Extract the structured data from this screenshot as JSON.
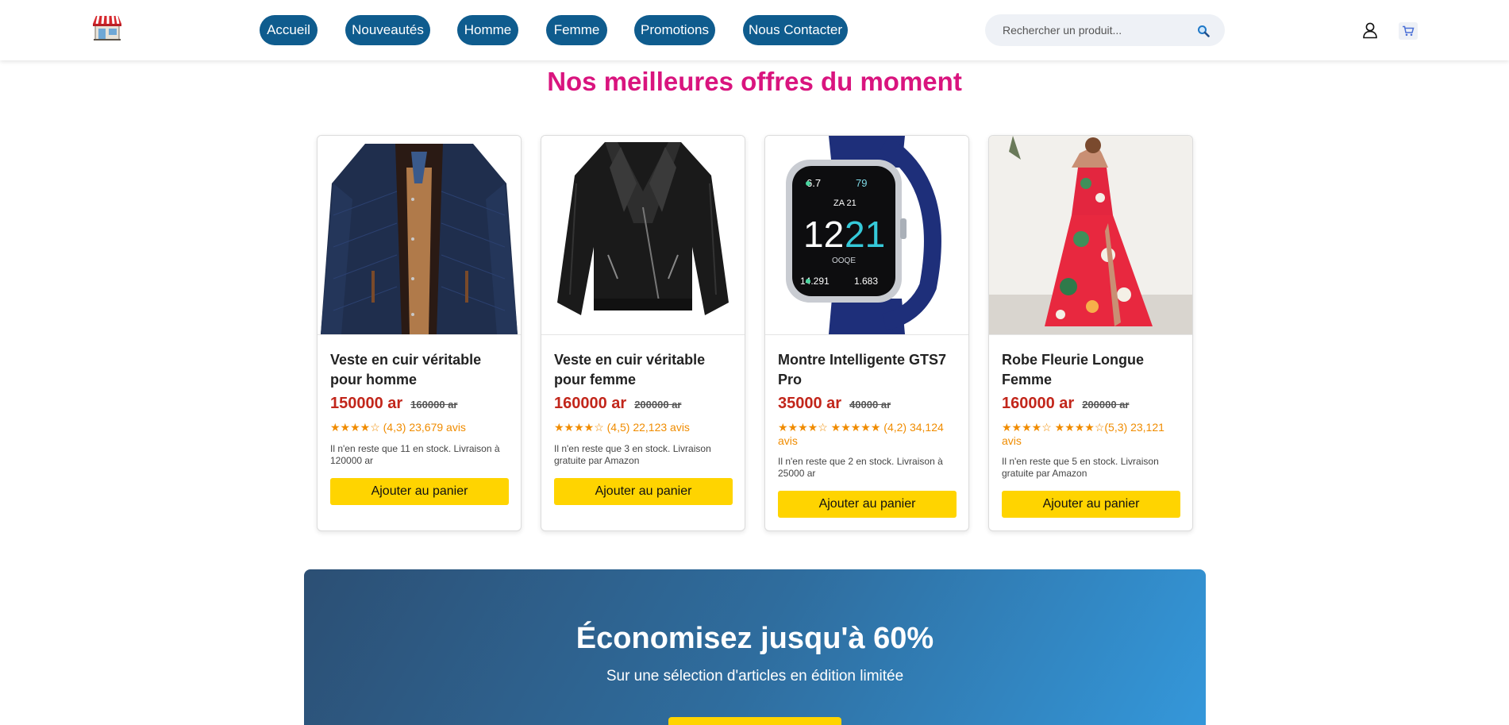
{
  "brand": {
    "logo_icon": "shop-storefront-icon"
  },
  "nav": {
    "items": [
      {
        "label": "Accueil"
      },
      {
        "label": "Nouveautés"
      },
      {
        "label": "Homme"
      },
      {
        "label": "Femme"
      },
      {
        "label": "Promotions"
      },
      {
        "label": "Nous Contacter"
      }
    ],
    "color": "#0f5c8e"
  },
  "search": {
    "placeholder": "Rechercher un produit...",
    "value": "",
    "icon": "search-icon"
  },
  "header_icons": {
    "user": "user-icon",
    "cart": "cart-icon"
  },
  "section": {
    "title": "Nos meilleures offres du moment",
    "title_color": "#d9147e"
  },
  "products": [
    {
      "name": "Veste en cuir véritable pour homme",
      "price": "150000 ar",
      "old_price": "160000 ar",
      "rating": "★★★★☆ (4,3) 23,679 avis",
      "stock": "Il n'en reste que 11 en stock. Livraison à 120000 ar",
      "button": "Ajouter au panier",
      "image": "navy-men-jacket"
    },
    {
      "name": "Veste en cuir véritable pour femme",
      "price": "160000 ar",
      "old_price": "200000 ar",
      "rating": "★★★★☆ (4,5) 22,123 avis",
      "stock": "Il n'en reste que 3 en stock. Livraison gratuite par Amazon",
      "button": "Ajouter au panier",
      "image": "black-leather-jacket"
    },
    {
      "name": "Montre Intelligente GTS7 Pro",
      "price": "35000 ar",
      "old_price": "40000 ar",
      "rating": "★★★★☆ ★★★★★ (4,2) 34,124 avis",
      "stock": "Il n'en reste que 2 en stock. Livraison à 25000 ar",
      "button": "Ajouter au panier",
      "image": "smartwatch",
      "watch_face": {
        "top_left": "6.7",
        "top_right": "79",
        "date": "ZA 21",
        "hour": "12",
        "minute": "21",
        "day": "OOQE",
        "bottom_left": "14.291",
        "bottom_right": "1.683"
      }
    },
    {
      "name": "Robe Fleurie Longue Femme",
      "price": "160000 ar",
      "old_price": "200000 ar",
      "rating": "★★★★☆ ★★★★☆(5,3) 23,121 avis",
      "stock": "Il n'en reste que 5 en stock. Livraison gratuite par Amazon",
      "button": "Ajouter au panier",
      "image": "floral-dress"
    }
  ],
  "promo": {
    "title": "Économisez jusqu'à 60%",
    "subtitle": "Sur une sélection d'articles en édition limitée"
  },
  "colors": {
    "price": "#c2261b",
    "rating": "#f08c00",
    "button": "#ffd400"
  }
}
